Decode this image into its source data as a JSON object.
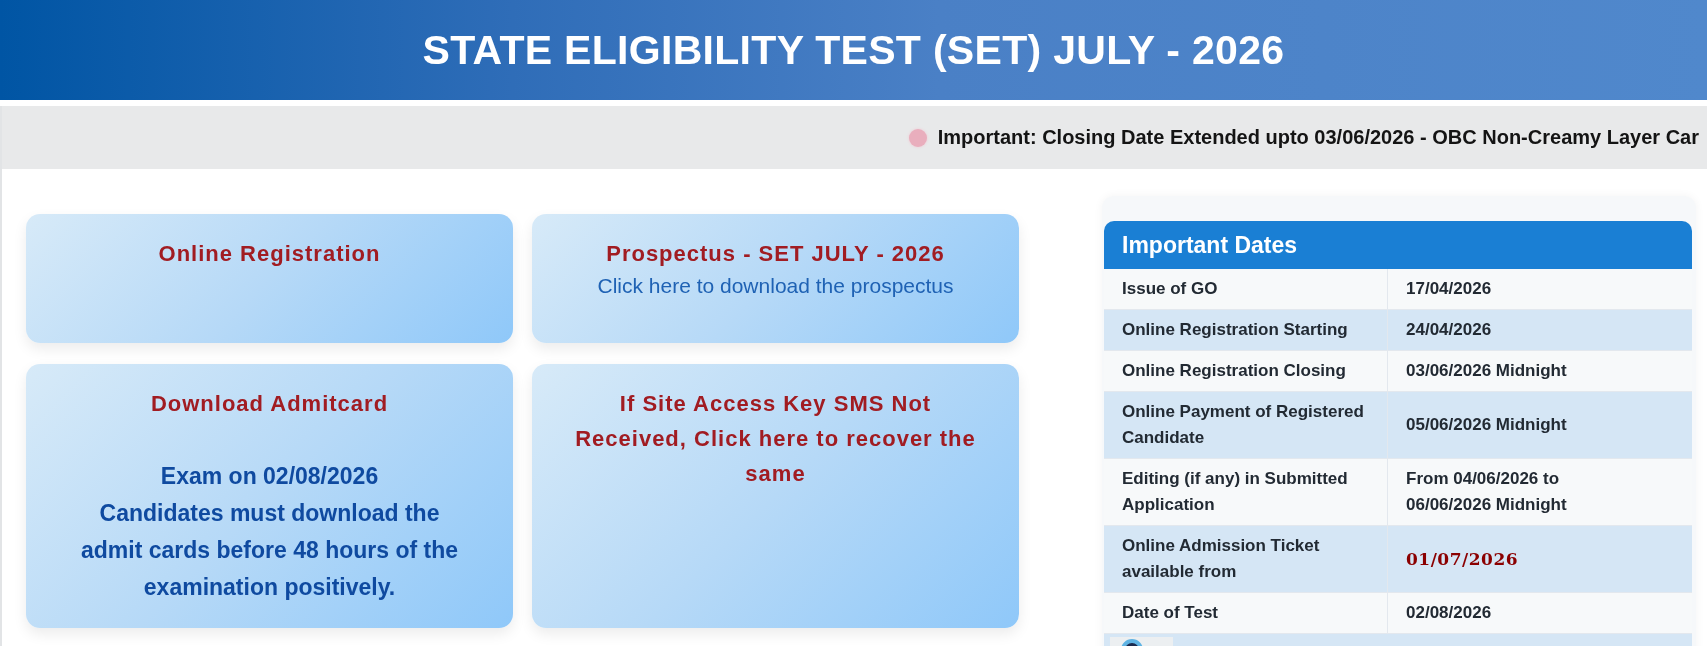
{
  "header": {
    "title": "STATE ELIGIBILITY TEST (SET) JULY - 2026"
  },
  "ticker": {
    "text": "Important: Closing Date Extended upto 03/06/2026 - OBC Non-Creamy Layer Car"
  },
  "cards": [
    {
      "title": "Online Registration"
    },
    {
      "title": "Prospectus - SET JULY - 2026",
      "subtitle": "Click here to download the prospectus"
    },
    {
      "title": "Download Admitcard",
      "notice": [
        "Exam on 02/08/2026",
        "Candidates must download the admit cards before 48 hours of the examination positively."
      ]
    },
    {
      "title": "If Site Access Key SMS Not Received, Click here to recover the same"
    }
  ],
  "important_dates": {
    "title": "Important Dates",
    "rows": [
      {
        "event": "Issue of GO",
        "date": "17/04/2026",
        "highlighted": false
      },
      {
        "event": "Online Registration Starting",
        "date": "24/04/2026",
        "highlighted": false
      },
      {
        "event": "Online Registration Closing",
        "date": "03/06/2026 Midnight",
        "highlighted": false
      },
      {
        "event": "Online Payment of Registered Candidate",
        "date": "05/06/2026 Midnight",
        "highlighted": false
      },
      {
        "event": "Editing (if any) in Submitted Application",
        "date": "From 04/06/2026 to 06/06/2026 Midnight",
        "highlighted": false
      },
      {
        "event": "Online Admission Ticket available from",
        "date": "01/07/2026",
        "highlighted": true
      },
      {
        "event": "Date of Test",
        "date": "02/08/2026",
        "highlighted": false
      }
    ]
  }
}
